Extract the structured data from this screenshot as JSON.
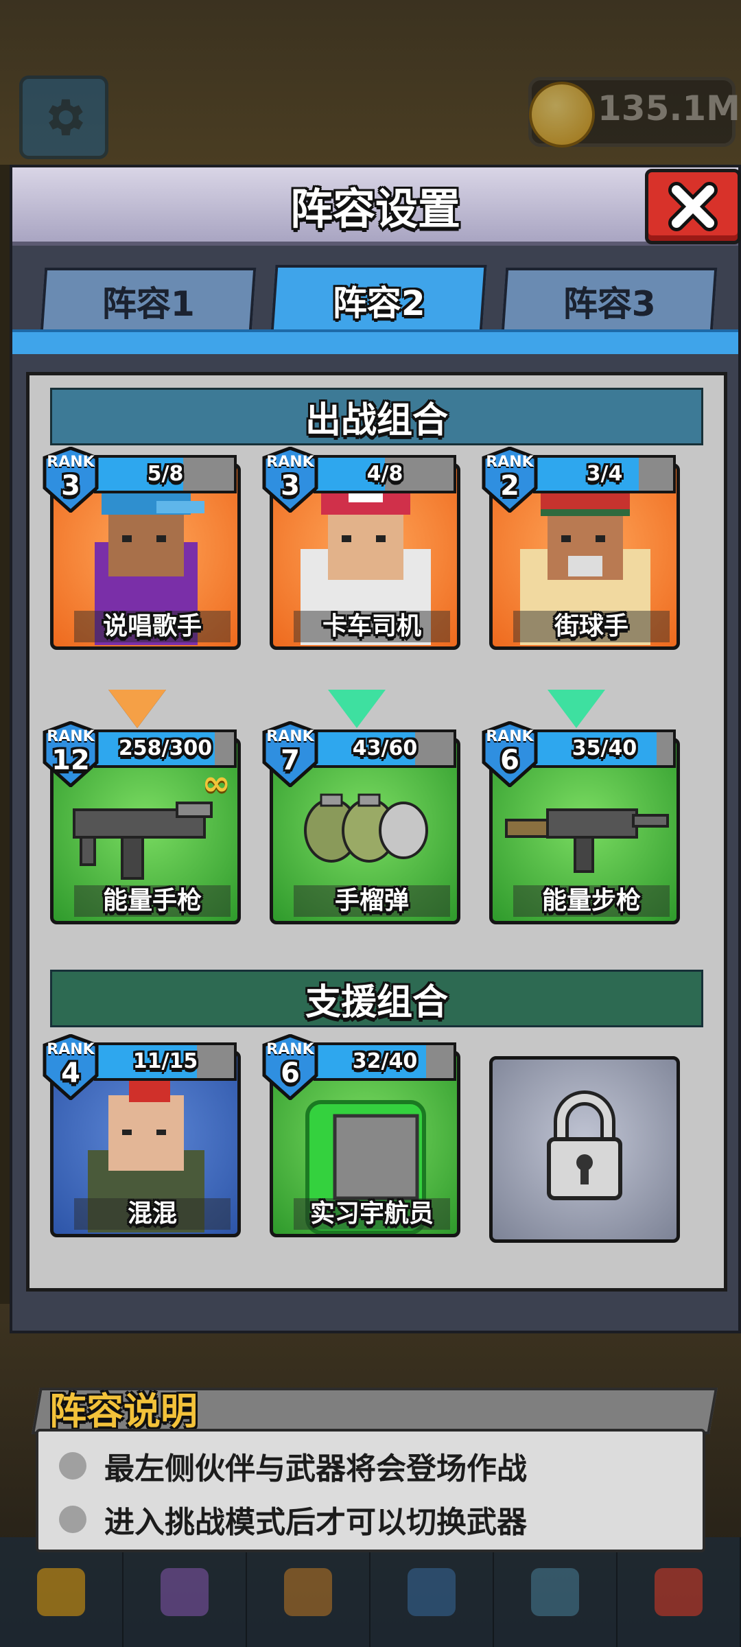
{
  "hud": {
    "coins": "135.1M"
  },
  "dialog": {
    "title": "阵容设置",
    "tabs": [
      "阵容1",
      "阵容2",
      "阵容3"
    ],
    "active_tab": 1
  },
  "battle_section": {
    "title": "出战组合",
    "partners": [
      {
        "rank_label": "RANK",
        "rank": "3",
        "progress": "5/8",
        "fill": 0.625,
        "name": "说唱歌手"
      },
      {
        "rank_label": "RANK",
        "rank": "3",
        "progress": "4/8",
        "fill": 0.5,
        "name": "卡车司机"
      },
      {
        "rank_label": "RANK",
        "rank": "2",
        "progress": "3/4",
        "fill": 0.75,
        "name": "街球手"
      }
    ],
    "weapons": [
      {
        "rank_label": "RANK",
        "rank": "12",
        "progress": "258/300",
        "fill": 0.86,
        "name": "能量手枪",
        "infinite": true
      },
      {
        "rank_label": "RANK",
        "rank": "7",
        "progress": "43/60",
        "fill": 0.72,
        "name": "手榴弹"
      },
      {
        "rank_label": "RANK",
        "rank": "6",
        "progress": "35/40",
        "fill": 0.875,
        "name": "能量步枪"
      }
    ]
  },
  "support_section": {
    "title": "支援组合",
    "members": [
      {
        "rank_label": "RANK",
        "rank": "4",
        "progress": "11/15",
        "fill": 0.73,
        "name": "混混"
      },
      {
        "rank_label": "RANK",
        "rank": "6",
        "progress": "32/40",
        "fill": 0.8,
        "name": "实习宇航员"
      }
    ]
  },
  "explanation": {
    "title": "阵容说明",
    "lines": [
      "最左侧伙伴与武器将会登场作战",
      "进入挑战模式后才可以切换武器"
    ]
  },
  "colors": {
    "accent": "#3fa4ea",
    "close": "#d8322a",
    "arrow_first": "#f5a046",
    "arrow_other": "#3ee0a0"
  }
}
